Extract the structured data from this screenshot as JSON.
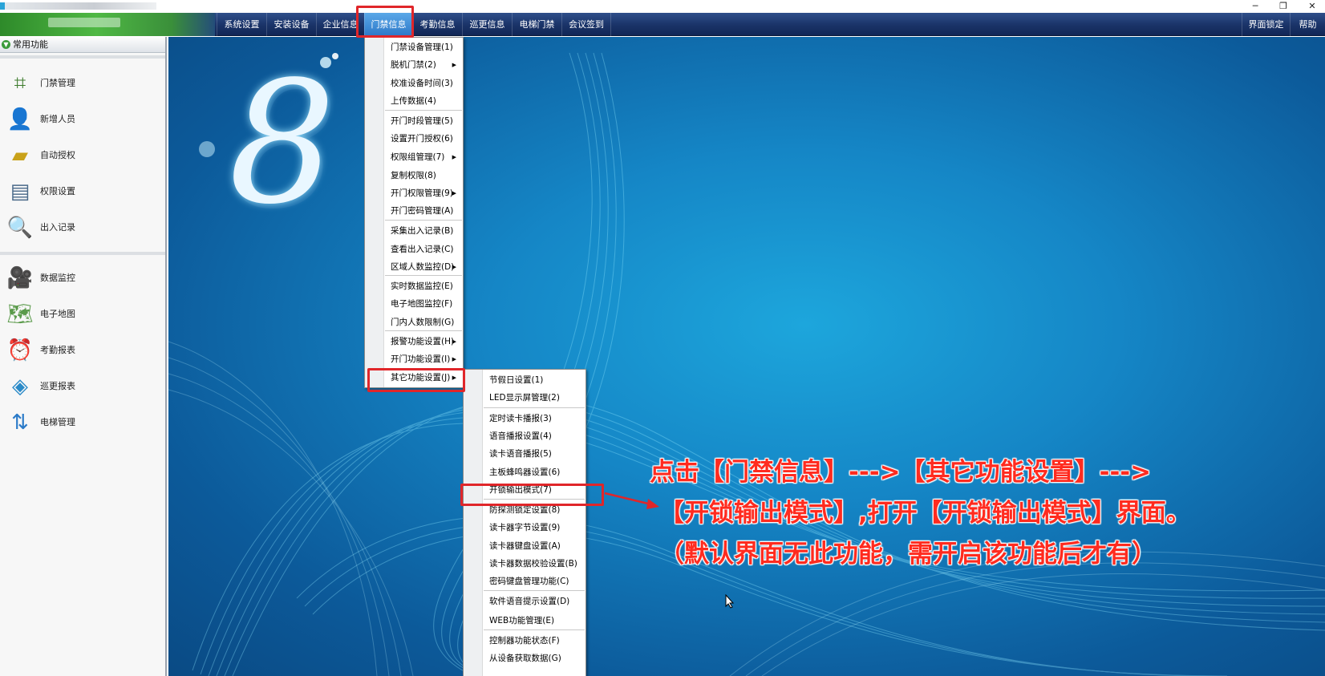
{
  "menubar": {
    "items": [
      "系统设置",
      "安装设备",
      "企业信息",
      "门禁信息",
      "考勤信息",
      "巡更信息",
      "电梯门禁",
      "会议签到"
    ],
    "right_items": [
      "界面锁定",
      "帮助"
    ]
  },
  "sidebar": {
    "header": "常用功能",
    "group1": [
      {
        "label": "门禁管理",
        "icon": "access-control-icon"
      },
      {
        "label": "新增人员",
        "icon": "person-icon"
      },
      {
        "label": "自动授权",
        "icon": "card-icon"
      },
      {
        "label": "权限设置",
        "icon": "document-icon"
      },
      {
        "label": "出入记录",
        "icon": "magnifier-icon"
      }
    ],
    "group2": [
      {
        "label": "数据监控",
        "icon": "camera-icon"
      },
      {
        "label": "电子地图",
        "icon": "map-icon"
      },
      {
        "label": "考勤报表",
        "icon": "clock-icon"
      },
      {
        "label": "巡更报表",
        "icon": "layers-icon"
      },
      {
        "label": "电梯管理",
        "icon": "elevator-icon"
      }
    ]
  },
  "menu_access": {
    "items": [
      "门禁设备管理(1)",
      "脱机门禁(2)",
      "校准设备时间(3)",
      "上传数据(4)",
      "开门时段管理(5)",
      "设置开门授权(6)",
      "权限组管理(7)",
      "复制权限(8)",
      "开门权限管理(9)",
      "开门密码管理(A)",
      "采集出入记录(B)",
      "查看出入记录(C)",
      "区域人数监控(D)",
      "实时数据监控(E)",
      "电子地图监控(F)",
      "门内人数限制(G)",
      "报警功能设置(H)",
      "开门功能设置(I)",
      "其它功能设置(J)"
    ]
  },
  "menu_other": {
    "items": [
      "节假日设置(1)",
      "LED显示屏管理(2)",
      "定时读卡播报(3)",
      "语音播报设置(4)",
      "读卡语音播报(5)",
      "主板蜂鸣器设置(6)",
      "开锁输出模式(7)",
      "防探测锁定设置(8)",
      "读卡器字节设置(9)",
      "读卡器键盘设置(A)",
      "读卡器数据校验设置(B)",
      "密码键盘管理功能(C)",
      "软件语音提示设置(D)",
      "WEB功能管理(E)",
      "控制器功能状态(F)",
      "从设备获取数据(G)"
    ]
  },
  "annotation": {
    "line1": "点击【门禁信息】--->【其它功能设置】--->",
    "line2": "【开锁输出模式】,打开【开锁输出模式】界面。",
    "line3": "（默认界面无此功能，需开启该功能后才有）"
  },
  "colors": {
    "highlight": "#e0262a",
    "annotation": "#ff2b1f",
    "menubar": "#1a3368",
    "desktop": "#1586c6"
  }
}
